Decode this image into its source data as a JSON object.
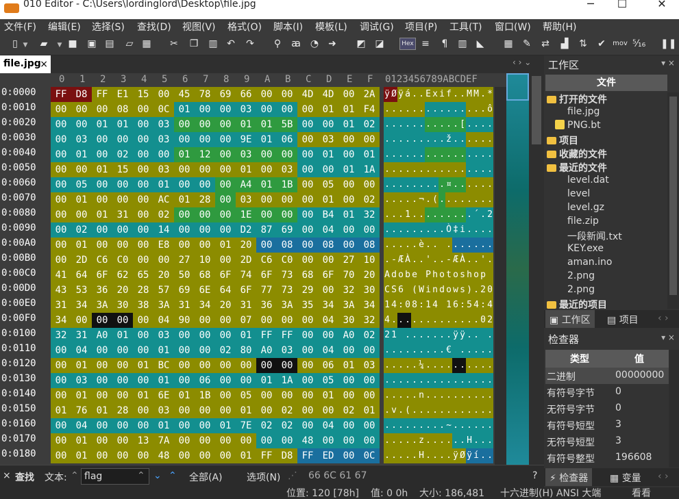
{
  "window": {
    "title": "010 Editor - C:\\Users\\lordinglord\\Desktop\\file.jpg",
    "minimize": "─",
    "maximize": "☐",
    "close": "✕"
  },
  "menu": [
    "文件(F)",
    "编辑(E)",
    "选择(S)",
    "查找(D)",
    "视图(V)",
    "格式(O)",
    "脚本(I)",
    "模板(L)",
    "调试(G)",
    "项目(P)",
    "工具(T)",
    "窗口(W)",
    "帮助(H)"
  ],
  "toolbar": {
    "icons": [
      "new-file-icon",
      "dropdown-icon",
      "open-file-icon",
      "dropdown-icon",
      "save-icon",
      "save-as-icon",
      "save-all-icon",
      "open-folder-icon",
      "workspace-icon",
      "cut-icon",
      "copy-icon",
      "paste-icon",
      "undo-icon",
      "redo-icon",
      "find-icon",
      "replace-icon",
      "find-in-files-icon",
      "goto-icon",
      "compare-icon",
      "template-icon",
      "hex-mode-icon",
      "text-mode-icon",
      "pilcrow-icon",
      "columns-icon",
      "highlight-icon",
      "calculator-icon",
      "script-icon",
      "swap-icon",
      "histogram-icon",
      "sort-icon",
      "checksum-icon",
      "mov-icon",
      "base-converter-icon",
      "pause-icon"
    ],
    "hex_label": "Hex",
    "mov_label": "mov"
  },
  "tab": {
    "label": "file.jpg",
    "close": "×"
  },
  "tab_nav": "‹ › ⌄",
  "hex": {
    "col_header": [
      "0",
      "1",
      "2",
      "3",
      "4",
      "5",
      "6",
      "7",
      "8",
      "9",
      "A",
      "B",
      "C",
      "D",
      "E",
      "F"
    ],
    "ascii_header": "0123456789ABCDEF",
    "rows": [
      {
        "addr": "0:0000",
        "bytes": [
          "FF",
          "D8",
          "FF",
          "E1",
          "15",
          "00",
          "45",
          "78",
          "69",
          "66",
          "00",
          "00",
          "4D",
          "4D",
          "00",
          "2A"
        ],
        "ascii": "ÿØÿá..Exif..MM.*"
      },
      {
        "addr": "0:0010",
        "bytes": [
          "00",
          "00",
          "00",
          "08",
          "00",
          "0C",
          "01",
          "00",
          "00",
          "03",
          "00",
          "00",
          "00",
          "01",
          "01",
          "F4"
        ],
        "ascii": "...............ô"
      },
      {
        "addr": "0:0020",
        "bytes": [
          "00",
          "00",
          "01",
          "01",
          "00",
          "03",
          "00",
          "00",
          "00",
          "01",
          "01",
          "5B",
          "00",
          "00",
          "01",
          "02"
        ],
        "ascii": "...........[...."
      },
      {
        "addr": "0:0030",
        "bytes": [
          "00",
          "03",
          "00",
          "00",
          "00",
          "03",
          "00",
          "00",
          "00",
          "9E",
          "01",
          "06",
          "00",
          "03",
          "00",
          "00"
        ],
        "ascii": ".........ž......"
      },
      {
        "addr": "0:0040",
        "bytes": [
          "00",
          "01",
          "00",
          "02",
          "00",
          "00",
          "01",
          "12",
          "00",
          "03",
          "00",
          "00",
          "00",
          "01",
          "00",
          "01"
        ],
        "ascii": "................"
      },
      {
        "addr": "0:0050",
        "bytes": [
          "00",
          "00",
          "01",
          "15",
          "00",
          "03",
          "00",
          "00",
          "00",
          "01",
          "00",
          "03",
          "00",
          "00",
          "01",
          "1A"
        ],
        "ascii": "................"
      },
      {
        "addr": "0:0060",
        "bytes": [
          "00",
          "05",
          "00",
          "00",
          "00",
          "01",
          "00",
          "00",
          "00",
          "A4",
          "01",
          "1B",
          "00",
          "05",
          "00",
          "00"
        ],
        "ascii": ".........¤......"
      },
      {
        "addr": "0:0070",
        "bytes": [
          "00",
          "01",
          "00",
          "00",
          "00",
          "AC",
          "01",
          "28",
          "00",
          "03",
          "00",
          "00",
          "00",
          "01",
          "00",
          "02"
        ],
        "ascii": ".....¬.(........"
      },
      {
        "addr": "0:0080",
        "bytes": [
          "00",
          "00",
          "01",
          "31",
          "00",
          "02",
          "00",
          "00",
          "00",
          "1E",
          "00",
          "00",
          "00",
          "B4",
          "01",
          "32"
        ],
        "ascii": "...1.........´.2"
      },
      {
        "addr": "0:0090",
        "bytes": [
          "00",
          "02",
          "00",
          "00",
          "00",
          "14",
          "00",
          "00",
          "00",
          "D2",
          "87",
          "69",
          "00",
          "04",
          "00",
          "00"
        ],
        "ascii": ".........Ò‡i...."
      },
      {
        "addr": "0:00A0",
        "bytes": [
          "00",
          "01",
          "00",
          "00",
          "00",
          "E8",
          "00",
          "00",
          "01",
          "20",
          "00",
          "08",
          "00",
          "08",
          "00",
          "08"
        ],
        "ascii": ".....è.. ......."
      },
      {
        "addr": "0:00B0",
        "bytes": [
          "00",
          "2D",
          "C6",
          "C0",
          "00",
          "00",
          "27",
          "10",
          "00",
          "2D",
          "C6",
          "C0",
          "00",
          "00",
          "27",
          "10"
        ],
        "ascii": ".-ÆÀ..'..-ÆÀ..'."
      },
      {
        "addr": "0:00C0",
        "bytes": [
          "41",
          "64",
          "6F",
          "62",
          "65",
          "20",
          "50",
          "68",
          "6F",
          "74",
          "6F",
          "73",
          "68",
          "6F",
          "70",
          "20"
        ],
        "ascii": "Adobe Photoshop "
      },
      {
        "addr": "0:00D0",
        "bytes": [
          "43",
          "53",
          "36",
          "20",
          "28",
          "57",
          "69",
          "6E",
          "64",
          "6F",
          "77",
          "73",
          "29",
          "00",
          "32",
          "30"
        ],
        "ascii": "CS6 (Windows).20"
      },
      {
        "addr": "0:00E0",
        "bytes": [
          "31",
          "34",
          "3A",
          "30",
          "38",
          "3A",
          "31",
          "34",
          "20",
          "31",
          "36",
          "3A",
          "35",
          "34",
          "3A",
          "34"
        ],
        "ascii": "14:08:14 16:54:4"
      },
      {
        "addr": "0:00F0",
        "bytes": [
          "34",
          "00",
          "00",
          "00",
          "00",
          "04",
          "90",
          "00",
          "00",
          "07",
          "00",
          "00",
          "00",
          "04",
          "30",
          "32"
        ],
        "ascii": "4.............02"
      },
      {
        "addr": "0:0100",
        "bytes": [
          "32",
          "31",
          "A0",
          "01",
          "00",
          "03",
          "00",
          "00",
          "00",
          "01",
          "FF",
          "FF",
          "00",
          "00",
          "A0",
          "02"
        ],
        "ascii": "21 .......ÿÿ.. ."
      },
      {
        "addr": "0:0110",
        "bytes": [
          "00",
          "04",
          "00",
          "00",
          "00",
          "01",
          "00",
          "00",
          "02",
          "80",
          "A0",
          "03",
          "00",
          "04",
          "00",
          "00"
        ],
        "ascii": ".........€ ....."
      },
      {
        "addr": "0:0120",
        "bytes": [
          "00",
          "01",
          "00",
          "00",
          "01",
          "BC",
          "00",
          "00",
          "00",
          "00",
          "00",
          "00",
          "00",
          "06",
          "01",
          "03"
        ],
        "ascii": ".....¼.........."
      },
      {
        "addr": "0:0130",
        "bytes": [
          "00",
          "03",
          "00",
          "00",
          "00",
          "01",
          "00",
          "06",
          "00",
          "00",
          "01",
          "1A",
          "00",
          "05",
          "00",
          "00"
        ],
        "ascii": "................"
      },
      {
        "addr": "0:0140",
        "bytes": [
          "00",
          "01",
          "00",
          "00",
          "01",
          "6E",
          "01",
          "1B",
          "00",
          "05",
          "00",
          "00",
          "00",
          "01",
          "00",
          "00"
        ],
        "ascii": ".....n.........."
      },
      {
        "addr": "0:0150",
        "bytes": [
          "01",
          "76",
          "01",
          "28",
          "00",
          "03",
          "00",
          "00",
          "00",
          "01",
          "00",
          "02",
          "00",
          "00",
          "02",
          "01"
        ],
        "ascii": ".v.(............"
      },
      {
        "addr": "0:0160",
        "bytes": [
          "00",
          "04",
          "00",
          "00",
          "00",
          "01",
          "00",
          "00",
          "01",
          "7E",
          "02",
          "02",
          "00",
          "04",
          "00",
          "00"
        ],
        "ascii": ".........~......"
      },
      {
        "addr": "0:0170",
        "bytes": [
          "00",
          "01",
          "00",
          "00",
          "13",
          "7A",
          "00",
          "00",
          "00",
          "00",
          "00",
          "00",
          "48",
          "00",
          "00",
          "00"
        ],
        "ascii": ".....z......H..."
      },
      {
        "addr": "0:0180",
        "bytes": [
          "00",
          "01",
          "00",
          "00",
          "00",
          "48",
          "00",
          "00",
          "00",
          "01",
          "FF",
          "D8",
          "FF",
          "ED",
          "00",
          "0C"
        ],
        "ascii": ".....H....ÿØÿí.."
      }
    ],
    "colors": {
      "olive": "#8c8c00",
      "teal": "#138f8f",
      "green": "#2f9a3f",
      "blue": "#1a6f9e",
      "maroon": "#7a1010",
      "gray": "#6a6a6a",
      "black": "#111111"
    },
    "row_colors": [
      "mmoooooooooooooo",
      "oooooottttttoooo",
      "ttttttggggggtttt",
      "ttttttttttttoooo",
      "ttttttggggggtttt",
      "ooooooooooootttt",
      "ttttttttggggoooo",
      "oooooooogooooooo",
      "ooooooggggggtttt",
      "tttttttttttttttt",
      "oooooooooobbbbbb",
      "oooooooooooooooo",
      "oooooooooooooooo",
      "oooooooooooooooo",
      "oooooooooooooooo",
      "ookkoooooooooooo",
      "tttttttttttttttt",
      "tttttttttttttttt",
      "ooooooooookkoooo",
      "tttttttttttttttt",
      "oooooooooooooooo",
      "oooooooooooooooo",
      "tttttttttttttttt",
      "ooooooooootttttt",
      "oooooooooooobbbb"
    ]
  },
  "workspace": {
    "title": "工作区",
    "files_header": "文件",
    "items": [
      {
        "type": "group",
        "label": "打开的文件"
      },
      {
        "type": "file",
        "label": "file.jpg"
      },
      {
        "type": "bt",
        "label": "PNG.bt"
      },
      {
        "type": "group",
        "label": "项目"
      },
      {
        "type": "group",
        "label": "收藏的文件"
      },
      {
        "type": "group",
        "label": "最近的文件"
      },
      {
        "type": "file",
        "label": "level.dat"
      },
      {
        "type": "file",
        "label": "level"
      },
      {
        "type": "file",
        "label": "level.gz"
      },
      {
        "type": "file",
        "label": "file.zip"
      },
      {
        "type": "file",
        "label": "一段新闻.txt"
      },
      {
        "type": "file",
        "label": "KEY.exe"
      },
      {
        "type": "file",
        "label": "aman.ino"
      },
      {
        "type": "file",
        "label": "2.png"
      },
      {
        "type": "file",
        "label": "2.png"
      },
      {
        "type": "group",
        "label": "最近的项目"
      }
    ],
    "tabs": [
      "工作区",
      "项目"
    ]
  },
  "inspector": {
    "title": "检查器",
    "col_type": "类型",
    "col_value": "值",
    "rows": [
      {
        "label": "二进制",
        "value": "00000000"
      },
      {
        "label": "有符号字节",
        "value": "0"
      },
      {
        "label": "无符号字节",
        "value": "0"
      },
      {
        "label": "有符号短型",
        "value": "3"
      },
      {
        "label": "无符号短型",
        "value": "3"
      },
      {
        "label": "有符号整型",
        "value": "196608"
      }
    ],
    "tabs": [
      "检查器",
      "变量"
    ]
  },
  "findbar": {
    "close": "×",
    "title": "查找",
    "text_label": "文本:",
    "query": "flag",
    "all": "全部(A)",
    "options": "选项(N)",
    "hex_preview": "66 6C 61 67",
    "help": "?"
  },
  "status": {
    "position": "位置: 120 [78h]",
    "value": "值: 0 0h",
    "size": "大小: 186,481",
    "encoding": "十六进制(H)  ANSI  大端",
    "view": "看看"
  }
}
